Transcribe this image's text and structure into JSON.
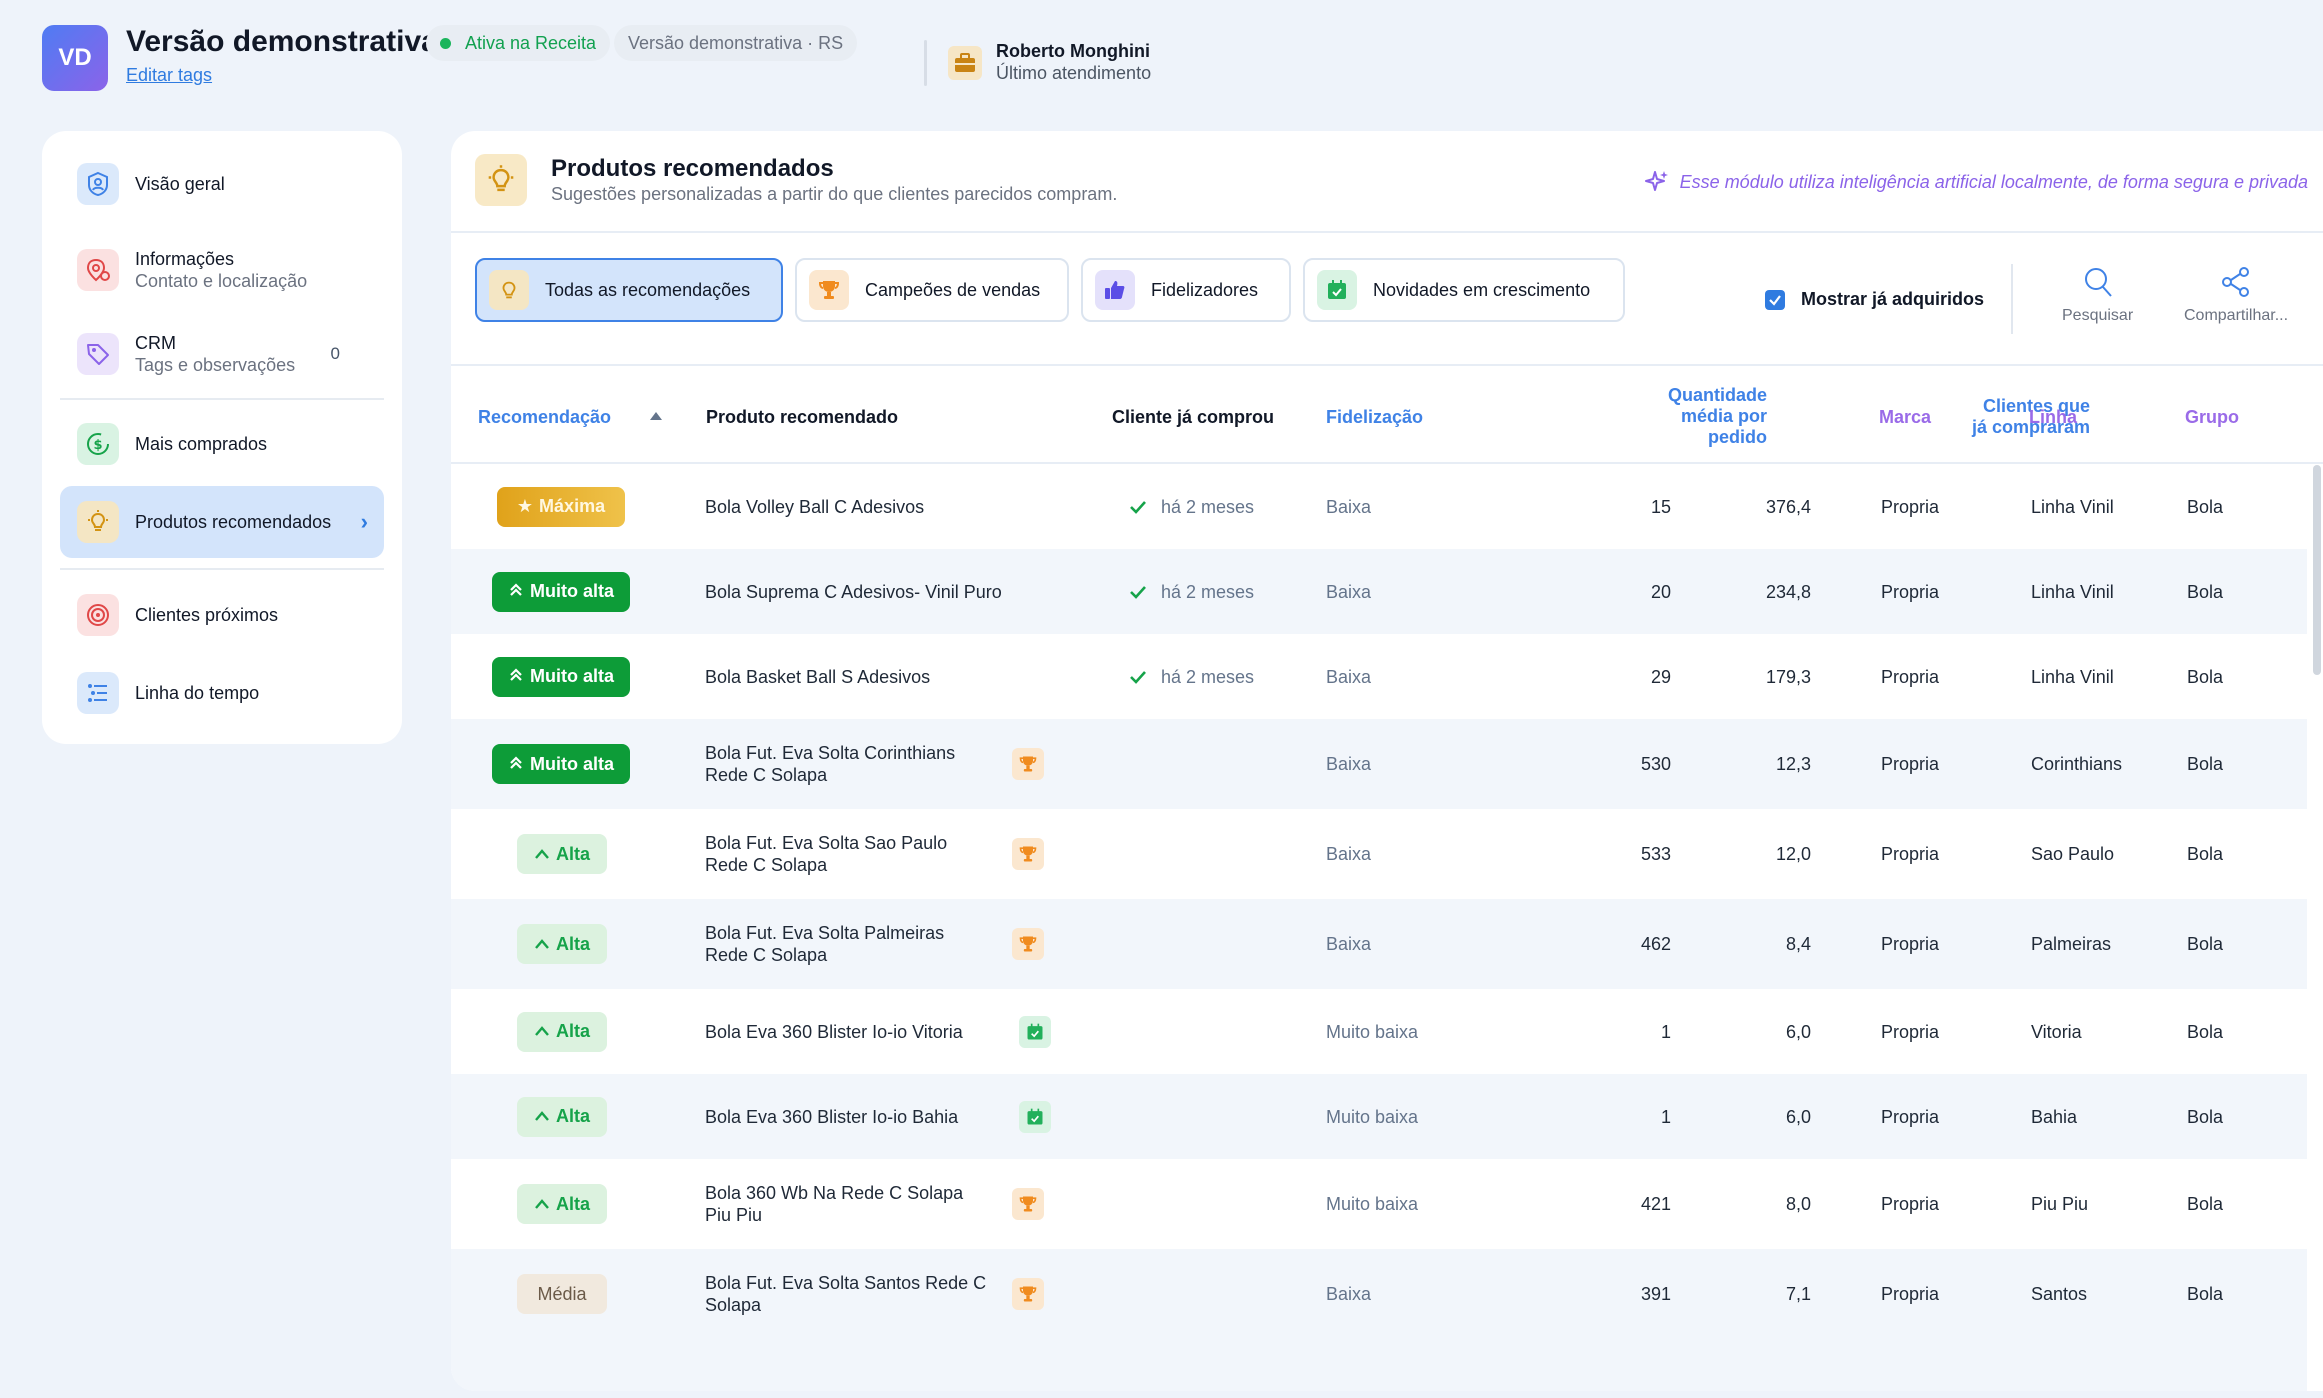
{
  "header": {
    "avatar_initials": "VD",
    "title": "Versão demonstrativa",
    "edit_tags": "Editar tags",
    "status": "Ativa na Receita",
    "edition": "Versão demonstrativa · RS",
    "agent_name": "Roberto Monghini",
    "agent_sub": "Último atendimento"
  },
  "sidebar": {
    "items": [
      {
        "label": "Visão geral",
        "sub": ""
      },
      {
        "label": "Informações",
        "sub": "Contato e localização"
      },
      {
        "label": "CRM",
        "sub": "Tags e observações",
        "count": "0"
      },
      {
        "label": "Mais comprados",
        "sub": ""
      },
      {
        "label": "Produtos recomendados",
        "sub": ""
      },
      {
        "label": "Clientes próximos",
        "sub": ""
      },
      {
        "label": "Linha do tempo",
        "sub": ""
      }
    ]
  },
  "panel": {
    "title": "Produtos recomendados",
    "subtitle": "Sugestões personalizadas a partir do que clientes parecidos compram.",
    "ai_note": "Esse módulo utiliza inteligência artificial localmente, de forma segura e privada"
  },
  "tabs": [
    {
      "label": "Todas as recomendações",
      "icon": "lightbulb-icon"
    },
    {
      "label": "Campeões de vendas",
      "icon": "trophy-icon"
    },
    {
      "label": "Fidelizadores",
      "icon": "thumbs-up-icon"
    },
    {
      "label": "Novidades em crescimento",
      "icon": "calendar-check-icon"
    }
  ],
  "toolbar": {
    "show_acquired": "Mostrar já adquiridos",
    "show_acquired_checked": true,
    "search": "Pesquisar",
    "share": "Compartilhar..."
  },
  "table": {
    "headers": {
      "recomendacao": "Recomendação",
      "produto": "Produto recomendado",
      "cliente": "Cliente já comprou",
      "fidelizacao": "Fidelização",
      "clientes_l1": "Clientes que",
      "clientes_l2": "já compraram",
      "qtd_l1": "Quantidade",
      "qtd_l2": "média por",
      "qtd_l3": "pedido",
      "marca": "Marca",
      "linha": "Linha",
      "grupo": "Grupo"
    },
    "rows": [
      {
        "rec": "Máxima",
        "p1": "Bola Volley Ball C  Adesivos",
        "p2": "",
        "bought": "há 2 meses",
        "tag": "",
        "fid": "Baixa",
        "clients": "15",
        "qty": "376,4",
        "marca": "Propria",
        "linha": "Linha Vinil",
        "grupo": "Bola"
      },
      {
        "rec": "Muito alta",
        "p1": "Bola Suprema C  Adesivos- Vinil Puro",
        "p2": "",
        "bought": "há 2 meses",
        "tag": "",
        "fid": "Baixa",
        "clients": "20",
        "qty": "234,8",
        "marca": "Propria",
        "linha": "Linha Vinil",
        "grupo": "Bola"
      },
      {
        "rec": "Muito alta",
        "p1": "Bola Basket Ball S  Adesivos",
        "p2": "",
        "bought": "há 2 meses",
        "tag": "",
        "fid": "Baixa",
        "clients": "29",
        "qty": "179,3",
        "marca": "Propria",
        "linha": "Linha Vinil",
        "grupo": "Bola"
      },
      {
        "rec": "Muito alta",
        "p1": "Bola Fut. Eva Solta Corinthians",
        "p2": "Rede C  Solapa",
        "bought": "",
        "tag": "trophy",
        "fid": "Baixa",
        "clients": "530",
        "qty": "12,3",
        "marca": "Propria",
        "linha": "Corinthians",
        "grupo": "Bola"
      },
      {
        "rec": "Alta",
        "p1": "Bola Fut. Eva Solta Sao Paulo",
        "p2": "Rede C  Solapa",
        "bought": "",
        "tag": "trophy",
        "fid": "Baixa",
        "clients": "533",
        "qty": "12,0",
        "marca": "Propria",
        "linha": "Sao Paulo",
        "grupo": "Bola"
      },
      {
        "rec": "Alta",
        "p1": "Bola Fut. Eva Solta Palmeiras",
        "p2": "Rede C  Solapa",
        "bought": "",
        "tag": "trophy",
        "fid": "Baixa",
        "clients": "462",
        "qty": "8,4",
        "marca": "Propria",
        "linha": "Palmeiras",
        "grupo": "Bola"
      },
      {
        "rec": "Alta",
        "p1": "Bola Eva 360  Blister   Io-io Vitoria",
        "p2": "",
        "bought": "",
        "tag": "calendar",
        "fid": "Muito baixa",
        "clients": "1",
        "qty": "6,0",
        "marca": "Propria",
        "linha": "Vitoria",
        "grupo": "Bola"
      },
      {
        "rec": "Alta",
        "p1": "Bola Eva 360  Blister   Io-io Bahia",
        "p2": "",
        "bought": "",
        "tag": "calendar",
        "fid": "Muito baixa",
        "clients": "1",
        "qty": "6,0",
        "marca": "Propria",
        "linha": "Bahia",
        "grupo": "Bola"
      },
      {
        "rec": "Alta",
        "p1": "Bola 360 Wb Na Rede C  Solapa",
        "p2": "Piu Piu",
        "bought": "",
        "tag": "trophy",
        "fid": "Muito baixa",
        "clients": "421",
        "qty": "8,0",
        "marca": "Propria",
        "linha": "Piu Piu",
        "grupo": "Bola"
      },
      {
        "rec": "Média",
        "p1": "Bola Fut. Eva Solta Santos Rede C",
        "p2": "Solapa",
        "bought": "",
        "tag": "trophy",
        "fid": "Baixa",
        "clients": "391",
        "qty": "7,1",
        "marca": "Propria",
        "linha": "Santos",
        "grupo": "Bola"
      }
    ]
  },
  "colors": {
    "accent": "#3f82e6",
    "purple": "#9a6be8",
    "very_high": "#0d9c38",
    "max_gold": "#e0a21a"
  }
}
